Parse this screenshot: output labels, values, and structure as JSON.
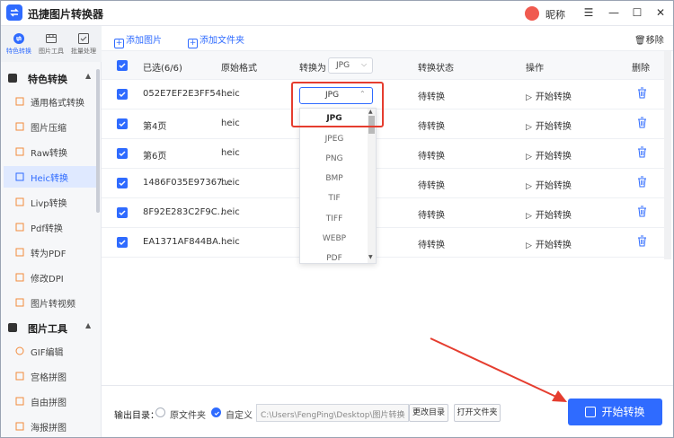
{
  "app": {
    "title": "迅捷图片转换器",
    "nickname": "昵称"
  },
  "rail": {
    "tabs": [
      {
        "label": "特色转换"
      },
      {
        "label": "图片工具"
      },
      {
        "label": "批量处理"
      }
    ],
    "groups": [
      {
        "label": "特色转换",
        "items": [
          {
            "label": "通用格式转换"
          },
          {
            "label": "图片压缩"
          },
          {
            "label": "Raw转换"
          },
          {
            "label": "Heic转换"
          },
          {
            "label": "Livp转换"
          },
          {
            "label": "Pdf转换"
          },
          {
            "label": "转为PDF"
          },
          {
            "label": "修改DPI"
          },
          {
            "label": "图片转视频"
          }
        ]
      },
      {
        "label": "图片工具",
        "items": [
          {
            "label": "GIF编辑"
          },
          {
            "label": "宫格拼图"
          },
          {
            "label": "自由拼图"
          },
          {
            "label": "海报拼图"
          }
        ]
      }
    ]
  },
  "toolbar": {
    "add_image": "添加图片",
    "add_folder": "添加文件夹",
    "remove": "移除"
  },
  "table": {
    "headers": {
      "selected": "已选(6/6)",
      "orig_format": "原始格式",
      "convert_to": "转换为",
      "head_format": "JPG",
      "status": "转换状态",
      "action": "操作",
      "delete": "删除"
    },
    "rows": [
      {
        "name": "052E7EF2E3FF54...",
        "format": "heic",
        "status": "待转换",
        "action": "开始转换"
      },
      {
        "name": "第4页",
        "format": "heic",
        "status": "待转换",
        "action": "开始转换"
      },
      {
        "name": "第6页",
        "format": "heic",
        "status": "待转换",
        "action": "开始转换"
      },
      {
        "name": "1486F035E97367...",
        "format": "heic",
        "status": "待转换",
        "action": "开始转换"
      },
      {
        "name": "8F92E283C2F9C...",
        "format": "heic",
        "status": "待转换",
        "action": "开始转换"
      },
      {
        "name": "EA1371AF844BA...",
        "format": "heic",
        "status": "待转换",
        "action": "开始转换"
      }
    ]
  },
  "dropdown": {
    "current": "JPG",
    "options": [
      "JPG",
      "JPEG",
      "PNG",
      "BMP",
      "TIF",
      "TIFF",
      "WEBP",
      "PDF"
    ]
  },
  "bottom": {
    "out_label": "输出目录：",
    "opt_source": "原文件夹",
    "opt_custom": "自定义",
    "path": "C:\\Users\\FengPing\\Desktop\\图片转换",
    "change_dir": "更改目录",
    "open_folder": "打开文件夹",
    "start": "开始转换"
  },
  "colors": {
    "accent": "#2f6bff",
    "highlight": "#e53d2f"
  }
}
